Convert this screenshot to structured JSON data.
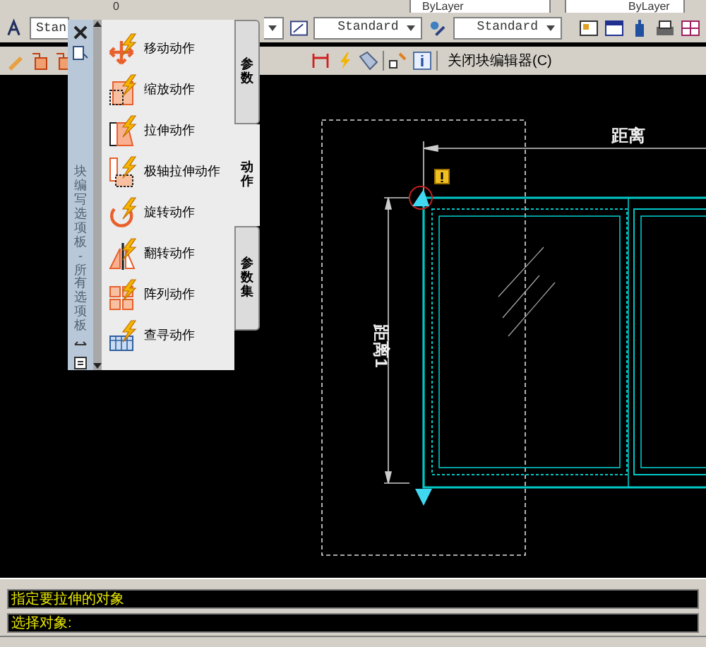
{
  "toolbar_top": {
    "layer": "0",
    "color_dropdown": "ByLayer",
    "lineweight": "ByLayer"
  },
  "toolbar_styles": {
    "text_style": "Stan",
    "dim_style": "Standard",
    "table_style": "Standard"
  },
  "block_editor_bar": {
    "close_button": "关闭块编辑器(C)"
  },
  "palette": {
    "title": "块编写选项板 - 所有选项板",
    "items": [
      {
        "kind": "move",
        "label": "移动动作"
      },
      {
        "kind": "scale",
        "label": "缩放动作"
      },
      {
        "kind": "stretch",
        "label": "拉伸动作"
      },
      {
        "kind": "polar",
        "label": "极轴拉伸动作"
      },
      {
        "kind": "rotate",
        "label": "旋转动作"
      },
      {
        "kind": "flip",
        "label": "翻转动作"
      },
      {
        "kind": "array",
        "label": "阵列动作"
      },
      {
        "kind": "lookup",
        "label": "查寻动作"
      }
    ],
    "tabs": [
      {
        "label": "参数",
        "selected": false
      },
      {
        "label": "动作",
        "selected": true
      },
      {
        "label": "参数集",
        "selected": false
      }
    ]
  },
  "drawing": {
    "horizontal_dimension": "距离",
    "vertical_dimension": "距离1"
  },
  "command_lines": [
    "指定要拉伸的对象",
    "选择对象:"
  ]
}
